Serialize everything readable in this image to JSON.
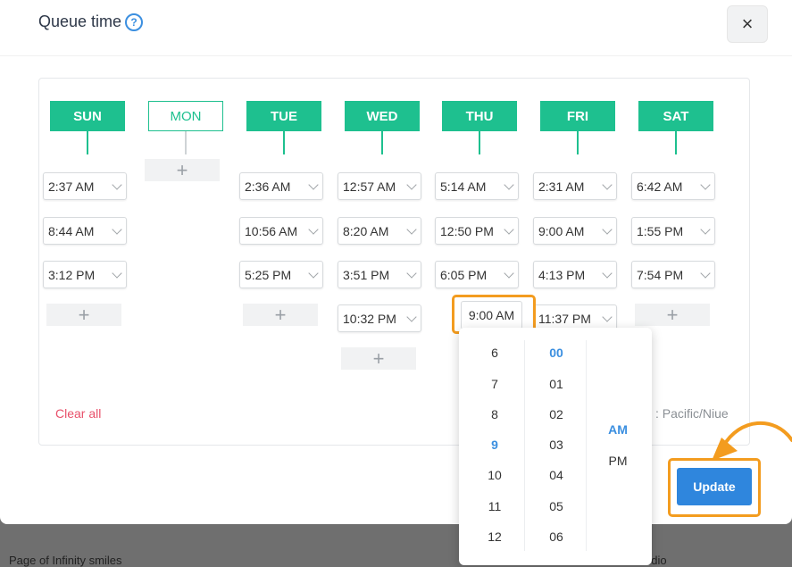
{
  "background": {
    "left_text": "Page of Infinity smiles",
    "right_text": "udio"
  },
  "modal": {
    "title": "Queue time",
    "help_icon": "?",
    "close_icon": "×",
    "clear_all": "Clear all",
    "timezone": ": Pacific/Niue",
    "update_label": "Update"
  },
  "add_icon": "+",
  "days": [
    {
      "label": "SUN",
      "style": "filled",
      "times": [
        "2:37 AM",
        "8:44 AM",
        "3:12 PM"
      ]
    },
    {
      "label": "MON",
      "style": "outline",
      "times": []
    },
    {
      "label": "TUE",
      "style": "filled",
      "times": [
        "2:36 AM",
        "10:56 AM",
        "5:25 PM"
      ]
    },
    {
      "label": "WED",
      "style": "filled",
      "times": [
        "12:57 AM",
        "8:20 AM",
        "3:51 PM",
        "10:32 PM"
      ]
    },
    {
      "label": "THU",
      "style": "filled",
      "times": [
        "5:14 AM",
        "12:50 PM",
        "6:05 PM"
      ]
    },
    {
      "label": "FRI",
      "style": "filled",
      "times": [
        "2:31 AM",
        "9:00 AM",
        "4:13 PM",
        "11:37 PM"
      ]
    },
    {
      "label": "SAT",
      "style": "filled",
      "times": [
        "6:42 AM",
        "1:55 PM",
        "7:54 PM"
      ]
    }
  ],
  "active_time": "9:00 AM",
  "picker": {
    "hours": [
      "6",
      "7",
      "8",
      "9",
      "10",
      "11",
      "12"
    ],
    "selected_hour": "9",
    "minutes": [
      "00",
      "01",
      "02",
      "03",
      "04",
      "05",
      "06"
    ],
    "selected_minute": "00",
    "periods": [
      "AM",
      "PM"
    ],
    "selected_period": "AM"
  },
  "colors": {
    "day_green": "#1ec08f",
    "highlight_orange": "#f39c1f",
    "update_blue": "#2f86dd",
    "danger_red": "#e8506a",
    "selected_blue": "#3b8fe0"
  }
}
